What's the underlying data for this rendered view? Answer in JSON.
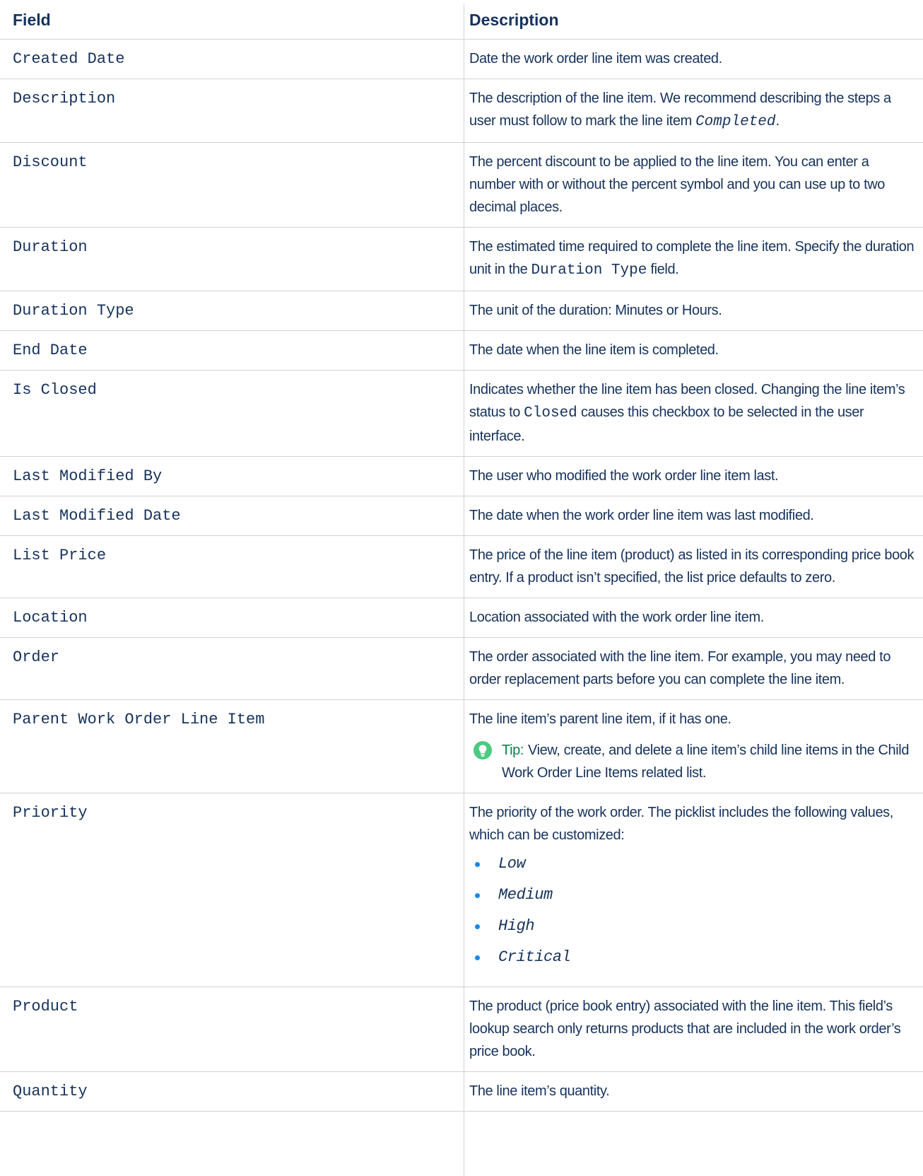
{
  "headers": {
    "field": "Field",
    "description": "Description"
  },
  "rows": {
    "created_date": {
      "field": "Created Date",
      "desc": "Date the work order line item was created."
    },
    "description": {
      "field": "Description",
      "desc_a": "The description of the line item. We recommend describing the steps a user must follow to mark the line item ",
      "desc_code": "Completed",
      "desc_b": "."
    },
    "discount": {
      "field": "Discount",
      "desc": "The percent discount to be applied to the line item. You can enter a number with or without the percent symbol and you can use up to two decimal places."
    },
    "duration": {
      "field": "Duration",
      "desc_a": "The estimated time required to complete the line item. Specify the duration unit in the ",
      "desc_code": "Duration Type",
      "desc_b": " field."
    },
    "duration_type": {
      "field": "Duration Type",
      "desc": "The unit of the duration: Minutes or Hours."
    },
    "end_date": {
      "field": "End Date",
      "desc": "The date when the line item is completed."
    },
    "is_closed": {
      "field": "Is Closed",
      "desc_a": "Indicates whether the line item has been closed. Changing the line item’s status to ",
      "desc_code": "Closed",
      "desc_b": " causes this checkbox to be selected in the user interface."
    },
    "last_modified_by": {
      "field": "Last Modified By",
      "desc": "The user who modified the work order line item last."
    },
    "last_modified_date": {
      "field": "Last Modified Date",
      "desc": "The date when the work order line item was last modified."
    },
    "list_price": {
      "field": "List Price",
      "desc": "The price of the line item (product) as listed in its corresponding price book entry. If a product isn’t specified, the list price defaults to zero."
    },
    "location": {
      "field": "Location",
      "desc": "Location associated with the work order line item."
    },
    "order": {
      "field": "Order",
      "desc": "The order associated with the line item. For example, you may need to order replacement parts before you can complete the line item."
    },
    "parent_line_item": {
      "field": "Parent Work Order Line Item",
      "desc": "The line item’s parent line item, if it has one.",
      "tip_label": "Tip:",
      "tip_text": "View, create, and delete a line item’s child line items in the Child Work Order Line Items related list."
    },
    "priority": {
      "field": "Priority",
      "desc": "The priority of the work order. The picklist includes the following values, which can be customized:",
      "values": [
        "Low",
        "Medium",
        "High",
        "Critical"
      ]
    },
    "product": {
      "field": "Product",
      "desc": "The product (price book entry) associated with the line item. This field’s lookup search only returns products that are included in the work order’s price book."
    },
    "quantity": {
      "field": "Quantity",
      "desc": "The line item’s quantity."
    }
  },
  "icons": {
    "tip": "lightbulb-icon"
  },
  "colors": {
    "text": "#16325c",
    "tip_green": "#04844b",
    "bullet": "#1589ee",
    "rule": "#cfd2d6"
  }
}
